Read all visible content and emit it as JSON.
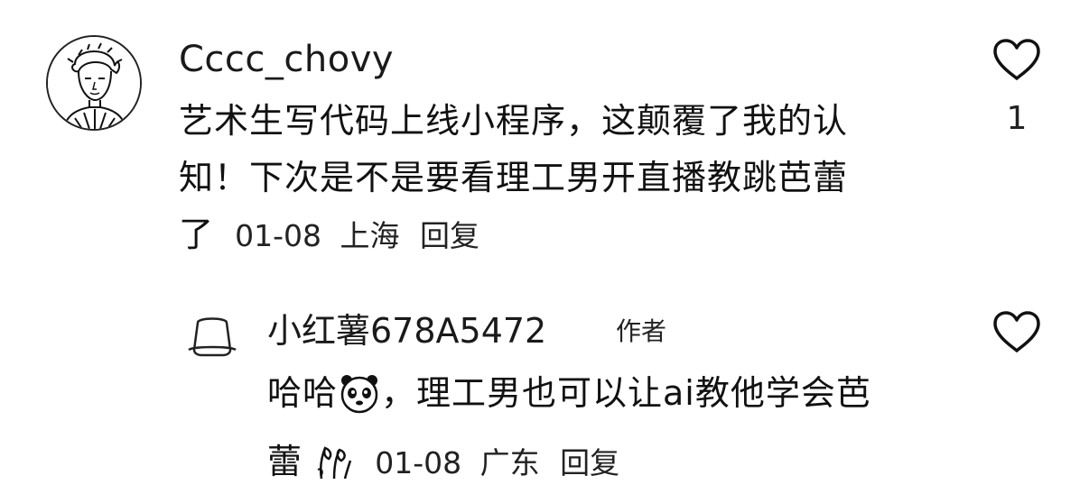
{
  "comments": [
    {
      "username": "Cccc_chovy",
      "text_line1": "艺术生写代码上线小程序，这颠覆了我的认",
      "text_line2": "知！下次是不是要看理工男开直播教跳芭蕾",
      "text_line3": "了",
      "date": "01-08",
      "location": "上海",
      "reply_label": "回复",
      "like_count": "1",
      "like_icon": "heart-outline-icon"
    },
    {
      "username": "小红薯678A5472",
      "author_tag": "作者",
      "text_line1_a": "哈哈",
      "text_line1_b": "，理工男也可以让ai教他学会芭",
      "text_line2": "蕾",
      "date": "01-08",
      "location": "广东",
      "reply_label": "回复",
      "emojis": [
        "panda-face-emoji",
        "flowers-emoji"
      ],
      "like_icon": "heart-outline-icon"
    }
  ],
  "colors": {
    "text": "#111111",
    "background": "#ffffff"
  }
}
